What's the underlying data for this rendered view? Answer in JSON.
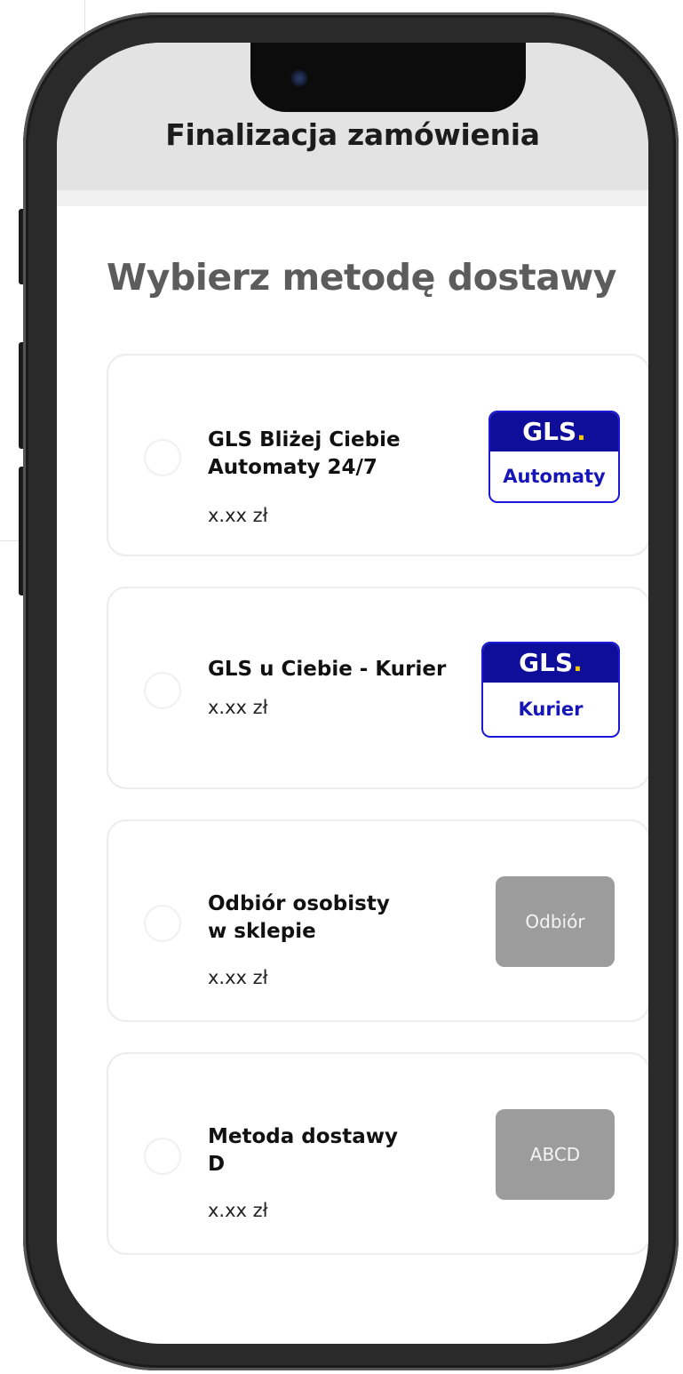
{
  "header": {
    "title": "Finalizacja zamówienia"
  },
  "section_title": "Wybierz metodę dostawy",
  "options": [
    {
      "name_line1": "GLS Bliżej Ciebie",
      "name_line2": "Automaty 24/7",
      "price": "x.xx zł",
      "logo": {
        "brand": "GLS",
        "dot": ".",
        "label": "Automaty"
      }
    },
    {
      "name_line1": "GLS u Ciebie - Kurier",
      "name_line2": "",
      "price": "x.xx zł",
      "logo": {
        "brand": "GLS",
        "dot": ".",
        "label": "Kurier"
      }
    },
    {
      "name_line1": "Odbiór osobisty",
      "name_line2": "w sklepie",
      "price": "x.xx zł",
      "logo": {
        "label": "Odbiór"
      }
    },
    {
      "name_line1": "Metoda dostawy",
      "name_line2": "D",
      "price": "x.xx zł",
      "logo": {
        "label": "ABCD"
      }
    }
  ],
  "colors": {
    "header_bg": "#e3e3e3",
    "gls_blue": "#0e0e9a",
    "gls_yellow": "#f7c600",
    "placeholder_logo": "#9c9c9c"
  }
}
